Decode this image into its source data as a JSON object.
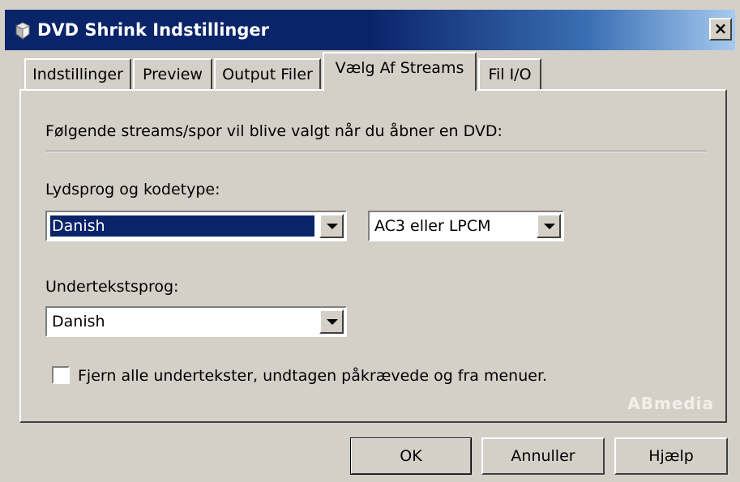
{
  "window": {
    "title": "DVD Shrink Indstillinger",
    "close_label": "×"
  },
  "tabs": [
    {
      "label": "Indstillinger",
      "active": false
    },
    {
      "label": "Preview",
      "active": false
    },
    {
      "label": "Output Filer",
      "active": false
    },
    {
      "label": "Vælg Af Streams",
      "active": true
    },
    {
      "label": "Fil I/O",
      "active": false
    }
  ],
  "panel": {
    "intro": "Følgende streams/spor vil blive valgt når du åbner en DVD:",
    "audio_label": "Lydsprog og kodetype:",
    "audio_language": "Danish",
    "audio_codec": "AC3 eller LPCM",
    "subtitle_label": "Undertekstsprog:",
    "subtitle_language": "Danish",
    "remove_subs_label": "Fjern alle undertekster, undtagen påkrævede og fra menuer.",
    "remove_subs_checked": false,
    "watermark": "ABmedia"
  },
  "buttons": {
    "ok": "OK",
    "cancel": "Annuller",
    "help": "Hjælp"
  },
  "colors": {
    "dialog_face": "#d4d0c8",
    "title_active": "#0a246a",
    "selection": "#0a246a"
  }
}
